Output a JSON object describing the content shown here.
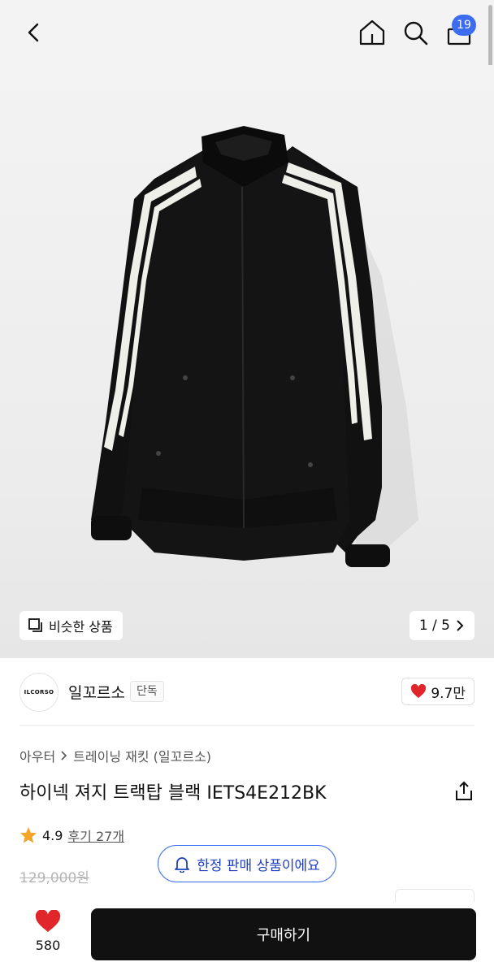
{
  "header": {
    "cart_count": "19"
  },
  "gallery": {
    "similar_label": "비슷한 상품",
    "pager_label": "1 / 5"
  },
  "brand": {
    "logo_text": "ILCORSO",
    "name": "일꼬르소",
    "tag": "단독",
    "likes": "9.7만"
  },
  "product": {
    "breadcrumb": [
      "아우터",
      "트레이닝 재킷 (일꼬르소)"
    ],
    "title": "하이넥 져지 트랙탑 블랙 IETS4E212BK",
    "rating": "4.9",
    "review_link": "후기 27개",
    "original_price": "129,000원"
  },
  "limited": {
    "label": "한정 판매 상품이에요"
  },
  "bottom": {
    "wish_count": "580",
    "buy_label": "구매하기"
  },
  "colors": {
    "accent": "#3c6df0",
    "heart": "#e0262b",
    "star": "#f2a42b"
  }
}
